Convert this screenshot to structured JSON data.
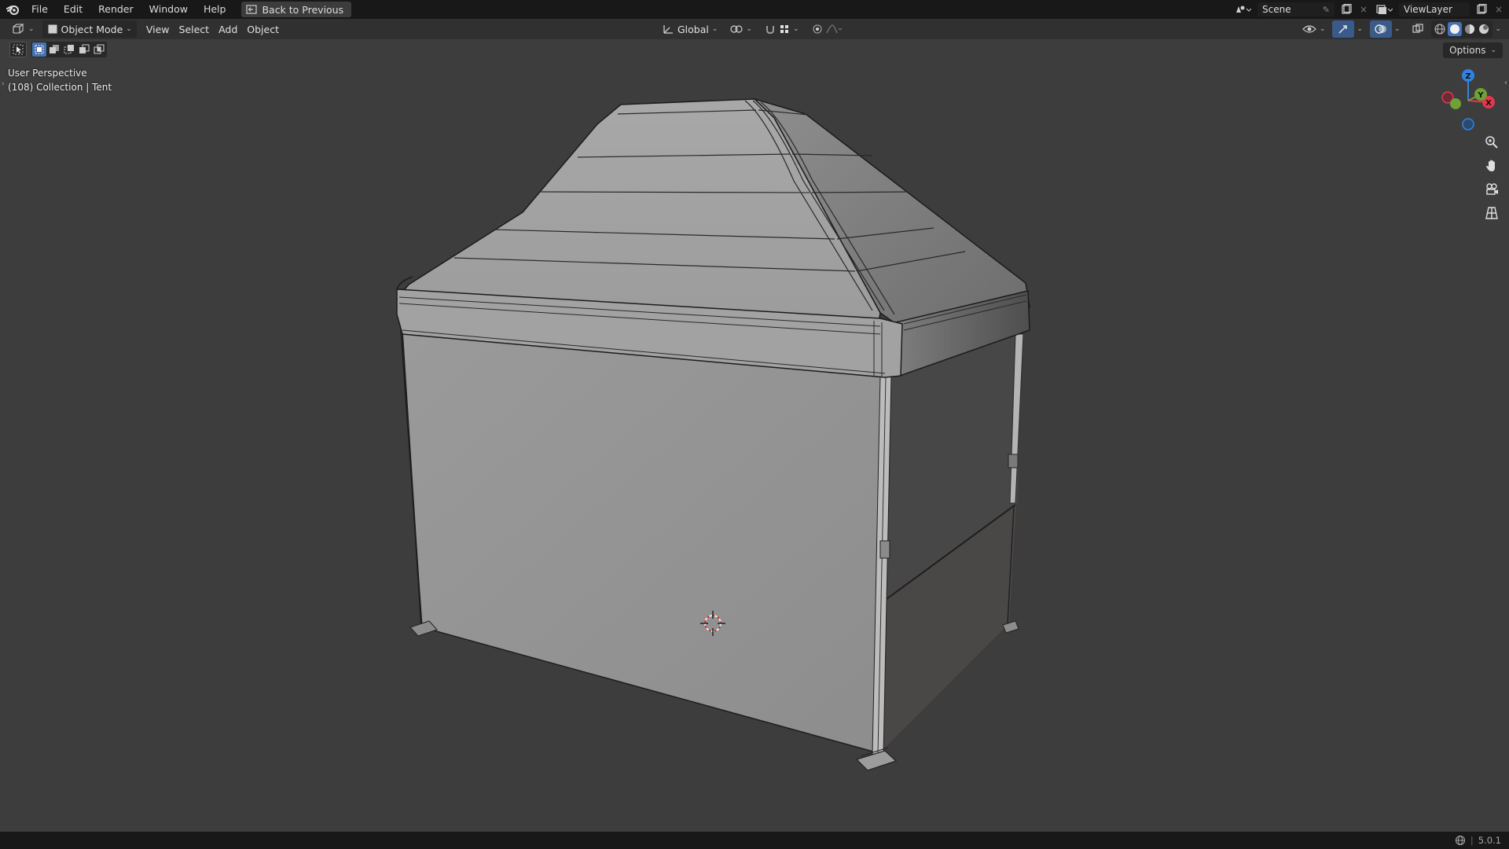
{
  "menubar": {
    "items": [
      "File",
      "Edit",
      "Render",
      "Window",
      "Help"
    ],
    "back_button": "Back to Previous",
    "scene": "Scene",
    "view_layer": "ViewLayer"
  },
  "header": {
    "mode": "Object Mode",
    "menus": [
      "View",
      "Select",
      "Add",
      "Object"
    ],
    "transform_orientation": "Global"
  },
  "options_label": "Options",
  "viewport": {
    "perspective": "User Perspective",
    "collection": "(108) Collection | Tent"
  },
  "gizmo": {
    "x": "X",
    "y": "Y",
    "z": "Z"
  },
  "status": {
    "version": "5.0.1"
  },
  "colors": {
    "accent": "#4772b3",
    "axis_x": "#e0394d",
    "axis_y": "#6ea136",
    "axis_z": "#2f83e3",
    "background": "#3d3d3d"
  },
  "icons": [
    "blender-logo",
    "back-icon",
    "scene-icon",
    "view-layer-icon",
    "editor-type-icon",
    "object-mode-icon",
    "transform-icon",
    "pivot-icon",
    "snap-icon",
    "proportional-icon",
    "overlay-icon",
    "gizmo-icon",
    "xray-icon",
    "shading-icons",
    "select-tool-icon",
    "zoom-icon",
    "pan-icon",
    "camera-icon",
    "grid-icon",
    "globe-icon"
  ]
}
